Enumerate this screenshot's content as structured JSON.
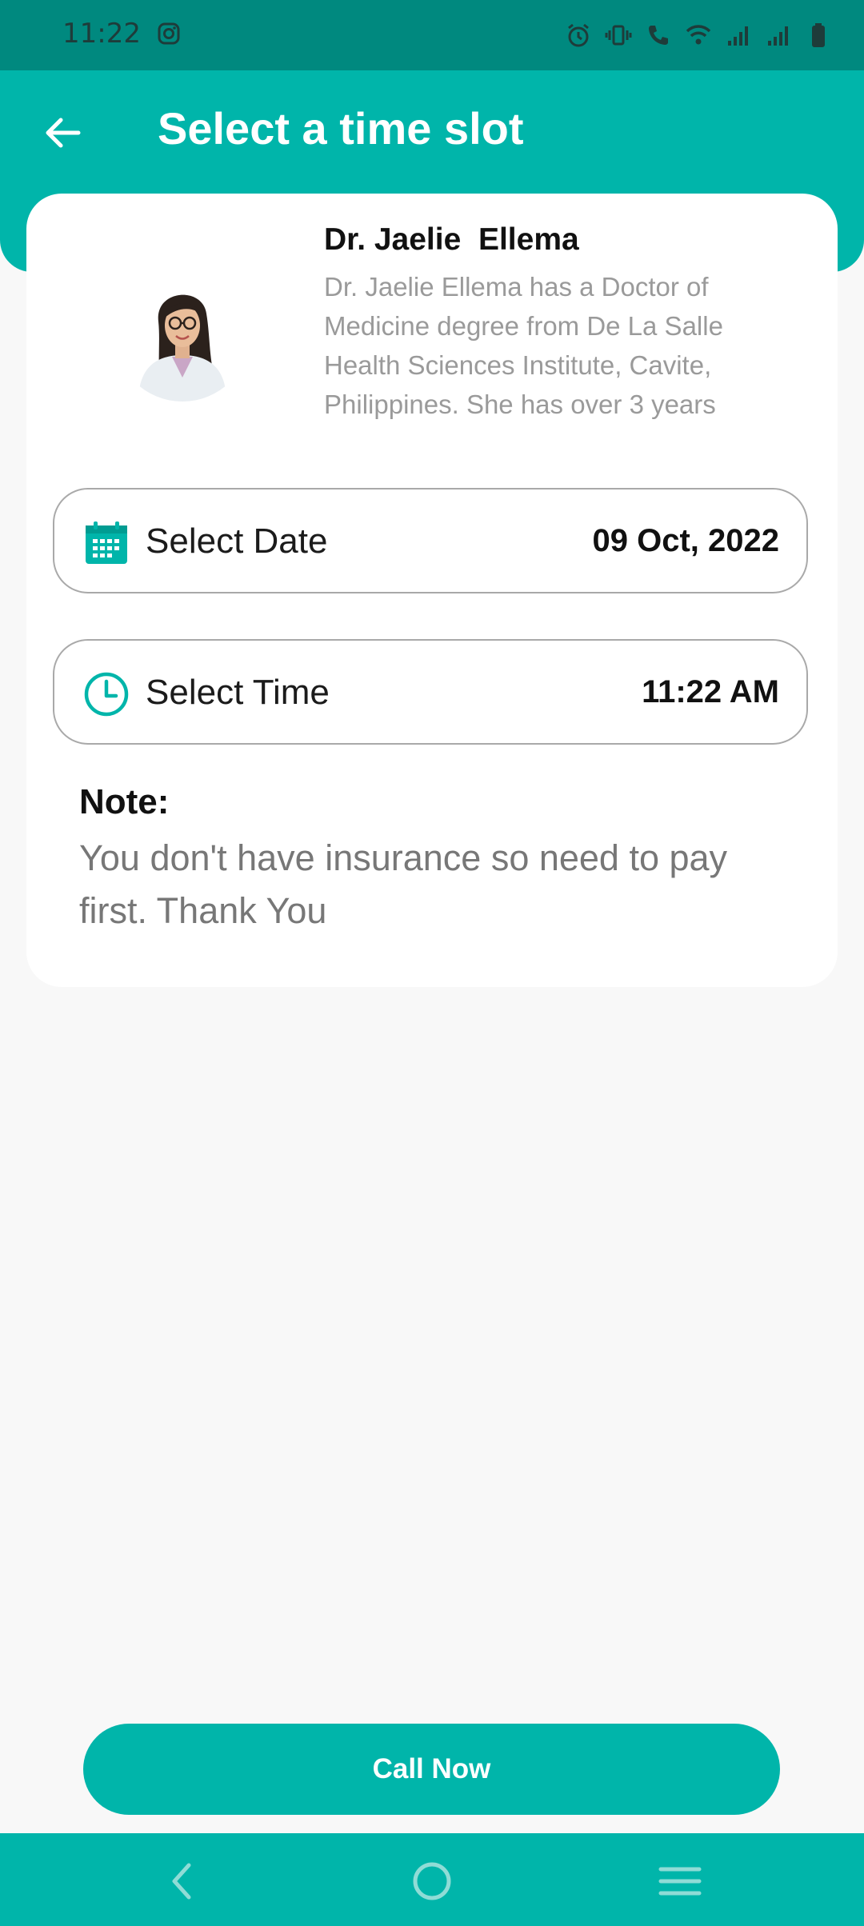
{
  "status_bar": {
    "time": "11:22",
    "icons": [
      "instagram-icon",
      "alarm-icon",
      "vibrate-icon",
      "call-icon",
      "wifi-icon",
      "signal-icon",
      "signal-icon",
      "battery-icon"
    ]
  },
  "header": {
    "title": "Select a time slot",
    "back_icon": "arrow-left-icon"
  },
  "doctor": {
    "name": "Dr. Jaelie  Ellema",
    "bio": "Dr. Jaelie Ellema has a Doctor of Medicine degree from De La Salle Health Sciences Institute, Cavite, Philippines. She has over 3 years",
    "photo_icon": "doctor-avatar"
  },
  "date_selector": {
    "label": "Select Date",
    "value": "09 Oct, 2022",
    "icon": "calendar-icon"
  },
  "time_selector": {
    "label": "Select Time",
    "value": "11:22 AM",
    "icon": "clock-icon"
  },
  "note": {
    "title": "Note:",
    "text": "You don't have insurance so need to pay first. Thank You"
  },
  "action": {
    "call_label": "Call Now"
  },
  "nav": {
    "items": [
      "back-nav-icon",
      "home-nav-icon",
      "menu-nav-icon"
    ]
  },
  "colors": {
    "primary": "#00b5aa",
    "status_bar": "#00897f",
    "background": "#f8f8f8"
  }
}
